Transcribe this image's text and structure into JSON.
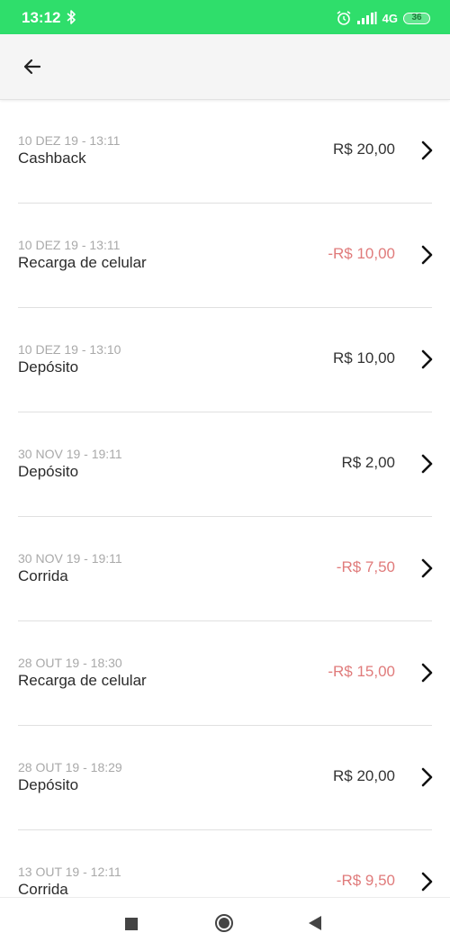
{
  "status_bar": {
    "time": "13:12",
    "network": "4G",
    "battery": "36",
    "icons": [
      "bluetooth-icon",
      "alarm-icon",
      "signal-icon",
      "battery-icon"
    ]
  },
  "app_bar": {
    "back_icon": "arrow-left-icon"
  },
  "transactions": [
    {
      "date": "10 DEZ 19 - 13:11",
      "description": "Cashback",
      "amount": "R$ 20,00",
      "type": "positive"
    },
    {
      "date": "10 DEZ 19 - 13:11",
      "description": "Recarga de celular",
      "amount": "-R$ 10,00",
      "type": "negative"
    },
    {
      "date": "10 DEZ 19 - 13:10",
      "description": "Depósito",
      "amount": "R$ 10,00",
      "type": "positive"
    },
    {
      "date": "30 NOV 19 - 19:11",
      "description": "Depósito",
      "amount": "R$ 2,00",
      "type": "positive"
    },
    {
      "date": "30 NOV 19 - 19:11",
      "description": "Corrida",
      "amount": "-R$ 7,50",
      "type": "negative"
    },
    {
      "date": "28 OUT 19 - 18:30",
      "description": "Recarga de celular",
      "amount": "-R$ 15,00",
      "type": "negative"
    },
    {
      "date": "28 OUT 19 - 18:29",
      "description": "Depósito",
      "amount": "R$ 20,00",
      "type": "positive"
    },
    {
      "date": "13 OUT 19 - 12:11",
      "description": "Corrida",
      "amount": "-R$ 9,50",
      "type": "negative"
    }
  ],
  "colors": {
    "status_bar": "#2fde6b",
    "positive_amount": "#333333",
    "negative_amount": "#e07b7b",
    "date_text": "#a9a9a9"
  },
  "nav_bar": {
    "icons": [
      "recents-square-icon",
      "home-circle-icon",
      "back-triangle-icon"
    ]
  }
}
